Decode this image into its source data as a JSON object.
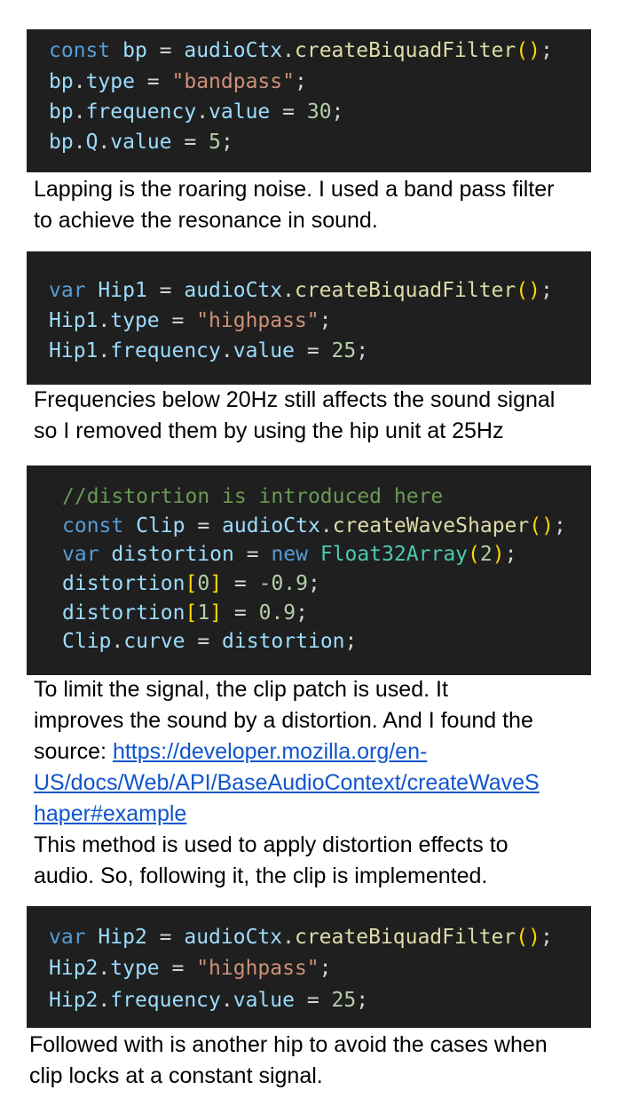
{
  "blocks": [
    {
      "code_lines": [
        [
          [
            "const",
            "kw"
          ],
          [
            " ",
            "pn"
          ],
          [
            "bp",
            "var"
          ],
          [
            " = ",
            "pn"
          ],
          [
            "audioCtx",
            "var"
          ],
          [
            ".",
            "pn"
          ],
          [
            "createBiquadFilter",
            "fn"
          ],
          [
            "()",
            "br"
          ],
          [
            ";",
            "pn"
          ]
        ],
        [
          [
            "bp",
            "var"
          ],
          [
            ".",
            "pn"
          ],
          [
            "type",
            "var"
          ],
          [
            " = ",
            "pn"
          ],
          [
            "\"bandpass\"",
            "str"
          ],
          [
            ";",
            "pn"
          ]
        ],
        [
          [
            "bp",
            "var"
          ],
          [
            ".",
            "pn"
          ],
          [
            "frequency",
            "var"
          ],
          [
            ".",
            "pn"
          ],
          [
            "value",
            "var"
          ],
          [
            " = ",
            "pn"
          ],
          [
            "30",
            "num"
          ],
          [
            ";",
            "pn"
          ]
        ],
        [
          [
            "bp",
            "var"
          ],
          [
            ".",
            "pn"
          ],
          [
            "Q",
            "var"
          ],
          [
            ".",
            "pn"
          ],
          [
            "value",
            "var"
          ],
          [
            " = ",
            "pn"
          ],
          [
            "5",
            "num"
          ],
          [
            ";",
            "pn"
          ]
        ]
      ],
      "text_lines": [
        "Lapping is the roaring noise. I used a band pass filter",
        "to achieve the resonance in sound."
      ]
    },
    {
      "code_lines": [
        [
          [
            "var",
            "kw"
          ],
          [
            " ",
            "pn"
          ],
          [
            "Hip1",
            "var"
          ],
          [
            " = ",
            "pn"
          ],
          [
            "audioCtx",
            "var"
          ],
          [
            ".",
            "pn"
          ],
          [
            "createBiquadFilter",
            "fn"
          ],
          [
            "()",
            "br"
          ],
          [
            ";",
            "pn"
          ]
        ],
        [
          [
            "Hip1",
            "var"
          ],
          [
            ".",
            "pn"
          ],
          [
            "type",
            "var"
          ],
          [
            " = ",
            "pn"
          ],
          [
            "\"highpass\"",
            "str"
          ],
          [
            ";",
            "pn"
          ]
        ],
        [
          [
            "Hip1",
            "var"
          ],
          [
            ".",
            "pn"
          ],
          [
            "frequency",
            "var"
          ],
          [
            ".",
            "pn"
          ],
          [
            "value",
            "var"
          ],
          [
            " = ",
            "pn"
          ],
          [
            "25",
            "num"
          ],
          [
            ";",
            "pn"
          ]
        ]
      ],
      "text_lines": [
        "Frequencies below 20Hz still affects the sound signal",
        "so I removed them by using the hip unit at 25Hz"
      ]
    },
    {
      "code_lines": [
        [
          [
            "//distortion is introduced here",
            "cmt"
          ]
        ],
        [
          [
            "const",
            "kw"
          ],
          [
            " ",
            "pn"
          ],
          [
            "Clip",
            "var"
          ],
          [
            " = ",
            "pn"
          ],
          [
            "audioCtx",
            "var"
          ],
          [
            ".",
            "pn"
          ],
          [
            "createWaveShaper",
            "fn"
          ],
          [
            "()",
            "br"
          ],
          [
            ";",
            "pn"
          ]
        ],
        [
          [
            "var",
            "kw"
          ],
          [
            " ",
            "pn"
          ],
          [
            "distortion",
            "var"
          ],
          [
            " = ",
            "pn"
          ],
          [
            "new",
            "kw"
          ],
          [
            " ",
            "pn"
          ],
          [
            "Float32Array",
            "cls"
          ],
          [
            "(",
            "br"
          ],
          [
            "2",
            "num"
          ],
          [
            ")",
            "br"
          ],
          [
            ";",
            "pn"
          ]
        ],
        [
          [
            "distortion",
            "var"
          ],
          [
            "[",
            "br"
          ],
          [
            "0",
            "num"
          ],
          [
            "]",
            "br"
          ],
          [
            " = ",
            "pn"
          ],
          [
            "-0.9",
            "num"
          ],
          [
            ";",
            "pn"
          ]
        ],
        [
          [
            "distortion",
            "var"
          ],
          [
            "[",
            "br"
          ],
          [
            "1",
            "num"
          ],
          [
            "]",
            "br"
          ],
          [
            " = ",
            "pn"
          ],
          [
            "0.9",
            "num"
          ],
          [
            ";",
            "pn"
          ]
        ],
        [
          [
            "Clip",
            "var"
          ],
          [
            ".",
            "pn"
          ],
          [
            "curve",
            "var"
          ],
          [
            " = ",
            "pn"
          ],
          [
            "distortion",
            "var"
          ],
          [
            ";",
            "pn"
          ]
        ]
      ],
      "text_lines": [
        "To limit the signal, the clip patch is used. It",
        "improves the sound by a distortion. And I found the"
      ],
      "source_label": "source: ",
      "link_lines": [
        "https://developer.mozilla.org/en-",
        "US/docs/Web/API/BaseAudioContext/createWaveS",
        "haper#example"
      ],
      "after_lines": [
        "This method is used to apply distortion effects to",
        "audio. So, following it, the clip is implemented."
      ]
    },
    {
      "code_lines": [
        [
          [
            "var",
            "kw"
          ],
          [
            " ",
            "pn"
          ],
          [
            "Hip2",
            "var"
          ],
          [
            " = ",
            "pn"
          ],
          [
            "audioCtx",
            "var"
          ],
          [
            ".",
            "pn"
          ],
          [
            "createBiquadFilter",
            "fn"
          ],
          [
            "()",
            "br"
          ],
          [
            ";",
            "pn"
          ]
        ],
        [
          [
            "Hip2",
            "var"
          ],
          [
            ".",
            "pn"
          ],
          [
            "type",
            "var"
          ],
          [
            " = ",
            "pn"
          ],
          [
            "\"highpass\"",
            "str"
          ],
          [
            ";",
            "pn"
          ]
        ],
        [
          [
            "Hip2",
            "var"
          ],
          [
            ".",
            "pn"
          ],
          [
            "frequency",
            "var"
          ],
          [
            ".",
            "pn"
          ],
          [
            "value",
            "var"
          ],
          [
            " = ",
            "pn"
          ],
          [
            "25",
            "num"
          ],
          [
            ";",
            "pn"
          ]
        ]
      ],
      "text_lines": [
        "Followed with is another hip to avoid the cases when",
        "clip locks at a constant signal."
      ]
    }
  ],
  "colors": {
    "code_background": "#1f1f1f",
    "keyword": "#569cd6",
    "variable": "#9cdcfe",
    "function": "#dcdcaa",
    "string": "#ce9178",
    "number": "#b5cea8",
    "class": "#4ec9b0",
    "comment": "#6a9955",
    "bracket": "#ffd700",
    "link": "#1155cc"
  }
}
